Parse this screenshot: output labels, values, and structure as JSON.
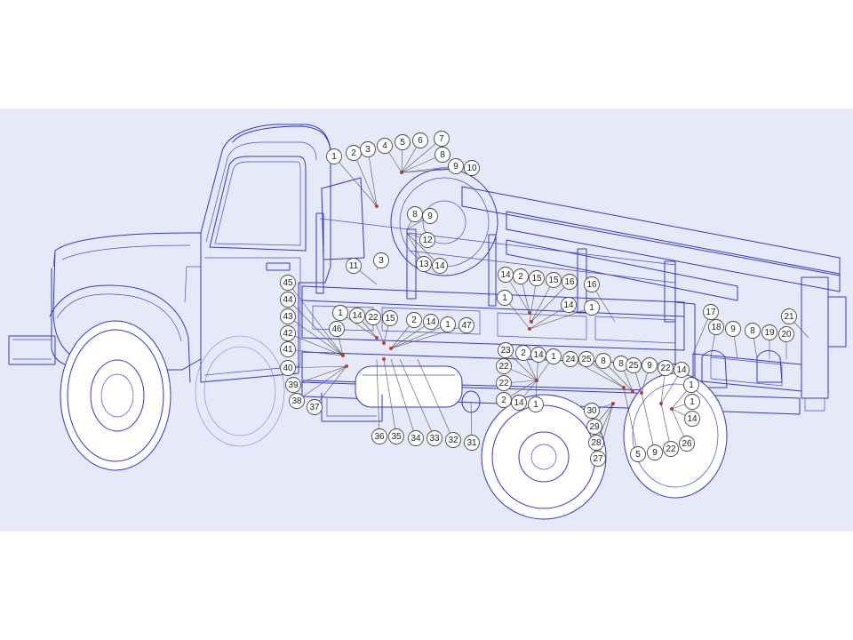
{
  "diagram": {
    "colors": {
      "viewport_background": "#e6eaf8",
      "line_ink": "#3535d0",
      "callout_circle": "#ffffff",
      "callout_text": "#222222",
      "part_marker": "#d23c2a"
    },
    "callouts": [
      "1",
      "2",
      "3",
      "4",
      "5",
      "6",
      "7",
      "8",
      "9",
      "10",
      "8",
      "9",
      "12",
      "13",
      "14",
      "11",
      "3",
      "14",
      "2",
      "15",
      "15",
      "16",
      "1",
      "16",
      "14",
      "1",
      "45",
      "44",
      "43",
      "42",
      "41",
      "40",
      "39",
      "38",
      "37",
      "1",
      "14",
      "22",
      "15",
      "46",
      "2",
      "14",
      "1",
      "47",
      "36",
      "35",
      "34",
      "33",
      "32",
      "31",
      "23",
      "2",
      "14",
      "1",
      "22",
      "22",
      "2",
      "14",
      "1",
      "24",
      "25",
      "8",
      "8",
      "25",
      "9",
      "22",
      "14",
      "1",
      "1",
      "14",
      "30",
      "29",
      "28",
      "27",
      "5",
      "9",
      "22",
      "26",
      "17",
      "18",
      "9",
      "8",
      "19",
      "20",
      "21"
    ]
  }
}
